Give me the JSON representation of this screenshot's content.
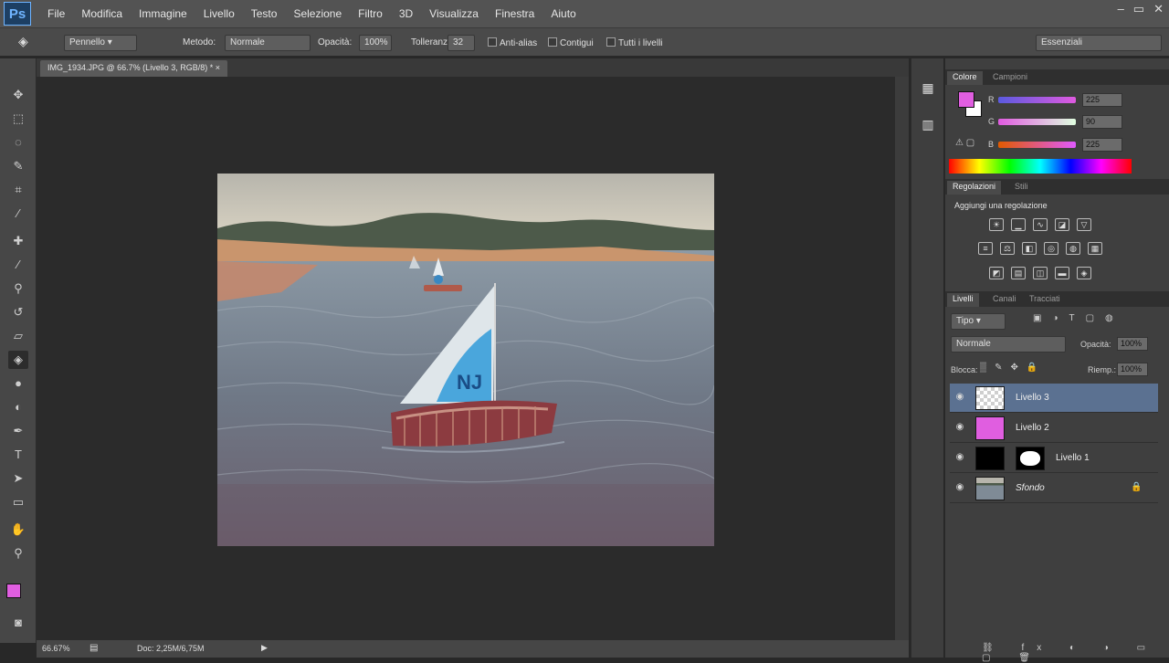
{
  "app": {
    "logo": "Ps"
  },
  "menu": [
    "File",
    "Modifica",
    "Immagine",
    "Livello",
    "Testo",
    "Selezione",
    "Filtro",
    "3D",
    "Visualizza",
    "Finestra",
    "Aiuto"
  ],
  "window_controls": [
    "–",
    "▭",
    "✕"
  ],
  "options": {
    "brush_preset": "Pennello ▾",
    "mode_label": "Metodo:",
    "mode_value": "Normale",
    "opacity_label": "Opacità:",
    "opacity_value": "100%",
    "tolerance_label": "Tolleranza:",
    "tolerance_value": "32",
    "antialias_label": "Anti-alias",
    "contiguous_label": "Contigui",
    "all_layers_label": "Tutti i livelli",
    "workspace": "Essenziali"
  },
  "document": {
    "tab_title": "IMG_1934.JPG @ 66.7% (Livello 3, RGB/8) *",
    "zoom": "66.67%",
    "doc_info": "Doc: 2,25M/6,75M"
  },
  "colors": {
    "foreground": "#e05ee0",
    "background": "#ffffff",
    "selection": "#5b7191",
    "app_bg": "#282828"
  },
  "color_panel": {
    "tabs": [
      "Colore",
      "Campioni"
    ],
    "channels": [
      {
        "label": "R",
        "value": "225"
      },
      {
        "label": "G",
        "value": "90"
      },
      {
        "label": "B",
        "value": "225"
      }
    ]
  },
  "adjustments_panel": {
    "tabs": [
      "Regolazioni",
      "Stili"
    ],
    "title": "Aggiungi una regolazione"
  },
  "layers_panel": {
    "tabs": [
      "Livelli",
      "Canali",
      "Tracciati"
    ],
    "kind_filter": "Tipo",
    "blend_mode": "Normale",
    "opacity_label": "Opacità:",
    "opacity_value": "100%",
    "lock_label": "Blocca:",
    "fill_label": "Riemp.:",
    "fill_value": "100%",
    "layers": [
      {
        "name": "Livello 3",
        "thumb": "transparent",
        "selected": true
      },
      {
        "name": "Livello 2",
        "thumb": "magenta",
        "selected": false
      },
      {
        "name": "Livello 1",
        "thumb": "mask",
        "selected": false
      },
      {
        "name": "Sfondo",
        "thumb": "photo",
        "selected": false,
        "locked": true
      }
    ]
  }
}
